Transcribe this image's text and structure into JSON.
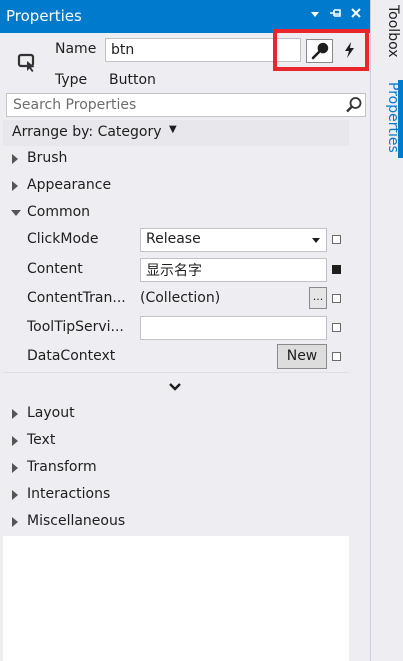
{
  "panel": {
    "title": "Properties",
    "name_label": "Name",
    "name_value": "btn",
    "type_label": "Type",
    "type_value": "Button",
    "search_placeholder": "Search Properties",
    "arrange_label": "Arrange by: Category"
  },
  "categories_top": [
    {
      "label": "Brush",
      "expanded": false
    },
    {
      "label": "Appearance",
      "expanded": false
    },
    {
      "label": "Common",
      "expanded": true
    }
  ],
  "common_properties": [
    {
      "name": "ClickMode",
      "value": "Release"
    },
    {
      "name": "Content",
      "value": "显示名字"
    },
    {
      "name": "ContentTran...",
      "value": "(Collection)"
    },
    {
      "name": "ToolTipServi...",
      "value": ""
    },
    {
      "name": "DataContext",
      "value": "New"
    }
  ],
  "categories_bottom": [
    {
      "label": "Layout"
    },
    {
      "label": "Text"
    },
    {
      "label": "Transform"
    },
    {
      "label": "Interactions"
    },
    {
      "label": "Miscellaneous"
    }
  ],
  "ellipsis_label": "...",
  "side_tabs": {
    "toolbox": "Toolbox",
    "properties": "Properties"
  },
  "colors": {
    "accent": "#007acc",
    "highlight": "#e8262b",
    "panel_bg": "#eeeef2"
  },
  "icons": [
    "dropdown-arrow-icon",
    "pin-icon",
    "close-icon",
    "element-icon",
    "wrench-icon",
    "lightning-icon",
    "search-icon",
    "chevron-down-icon"
  ]
}
